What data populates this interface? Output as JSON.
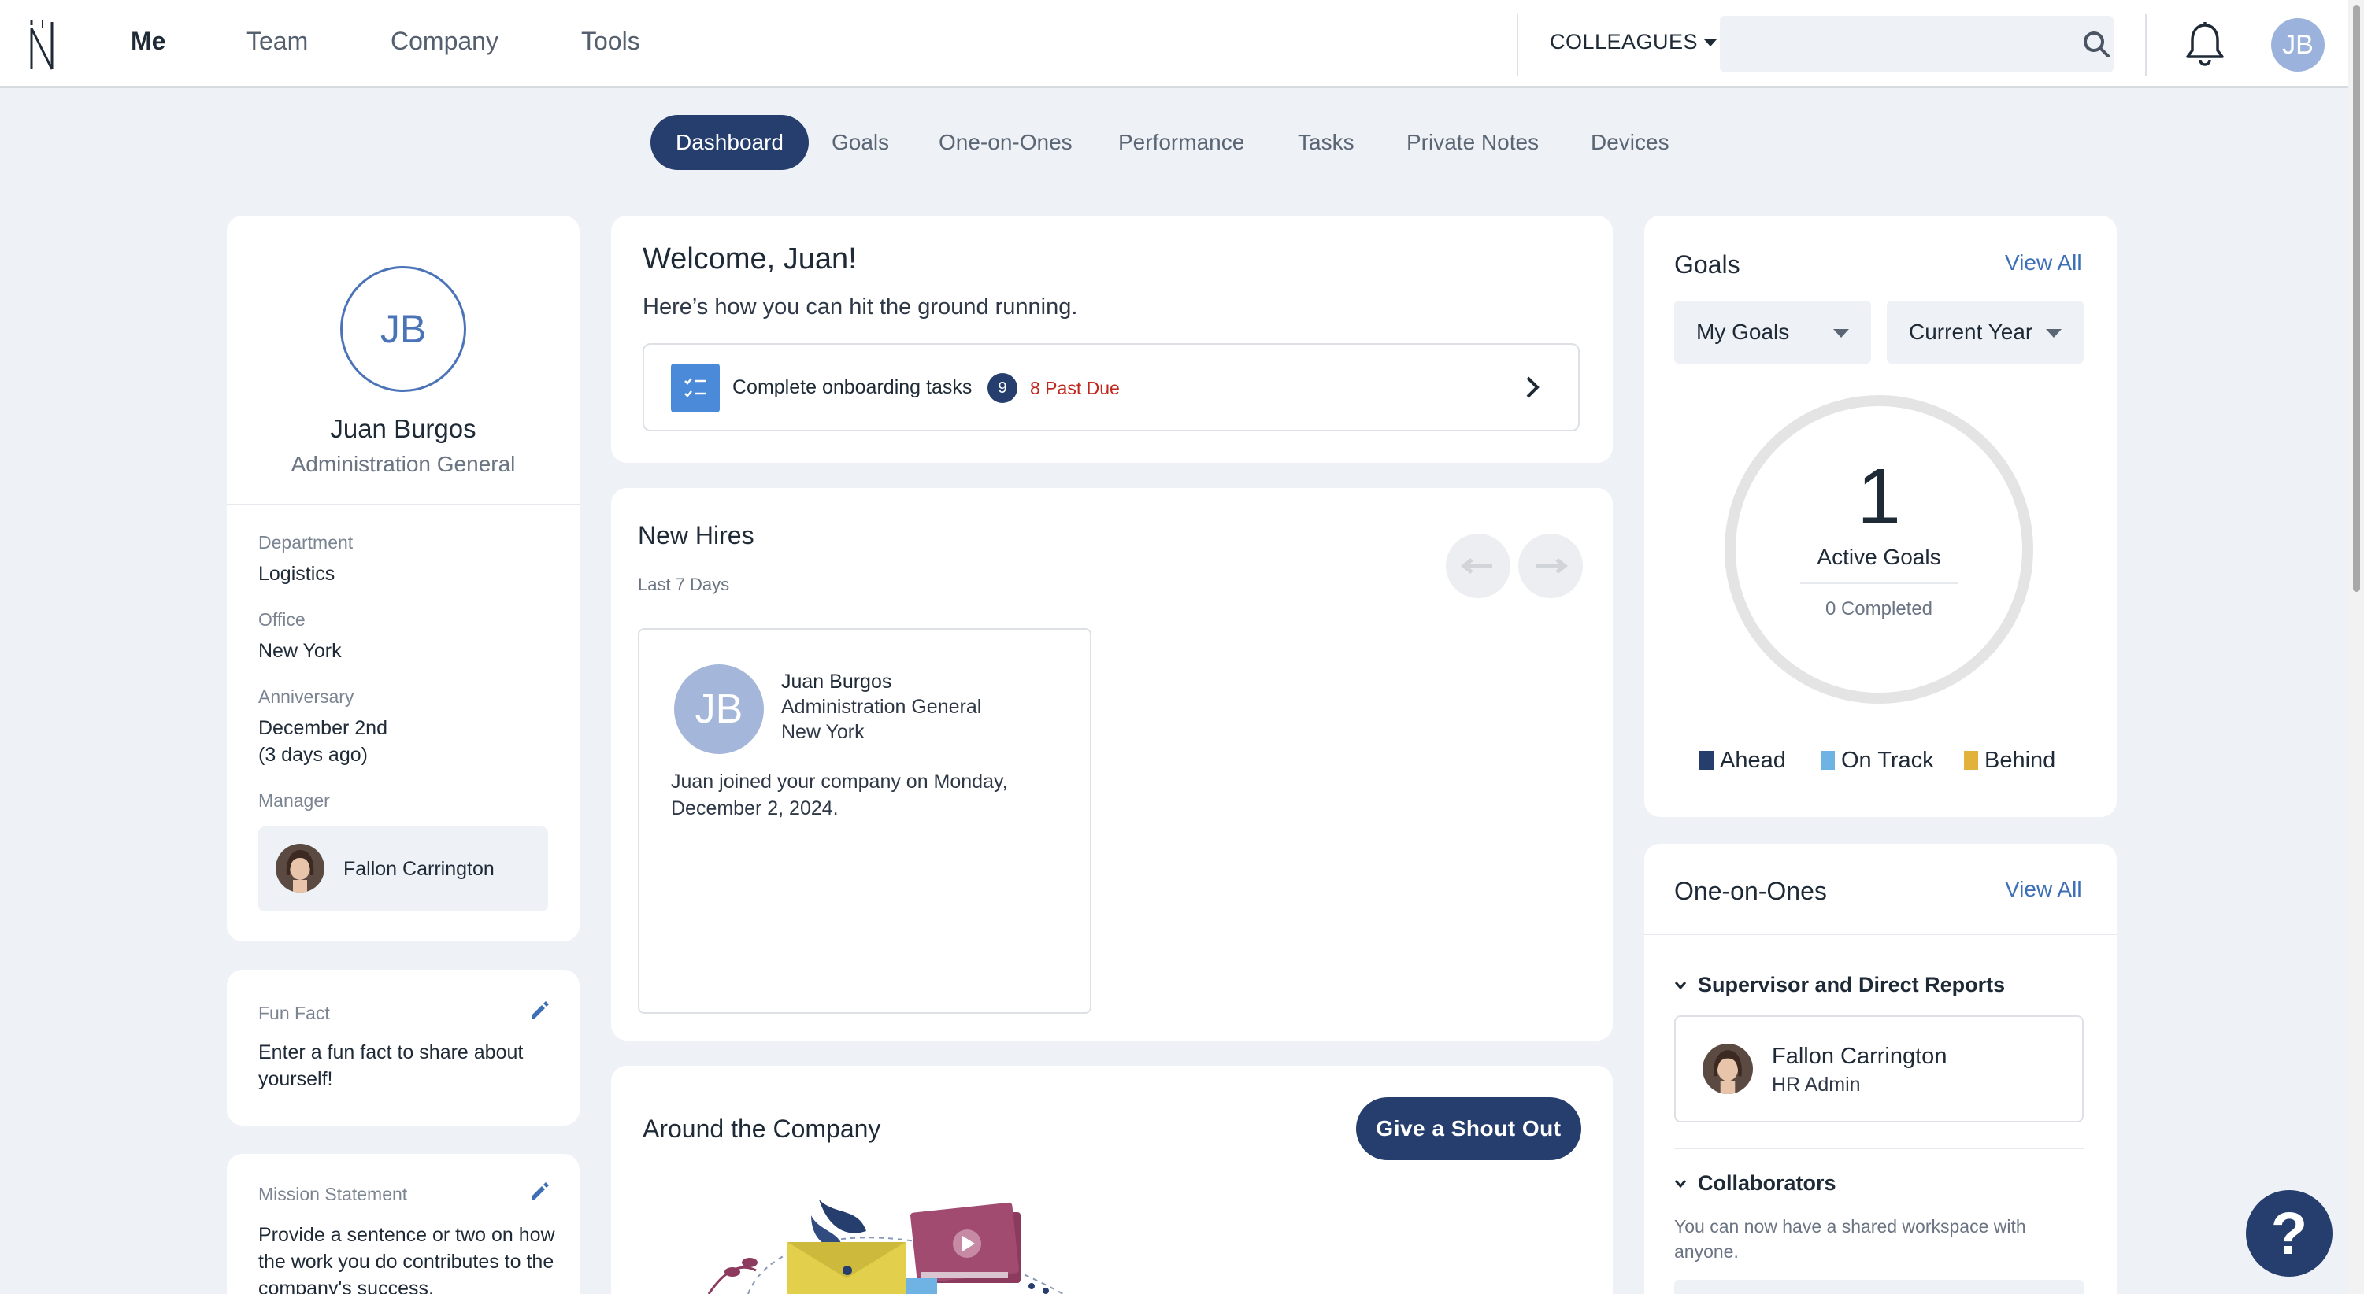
{
  "nav": {
    "items": [
      {
        "label": "Me"
      },
      {
        "label": "Team"
      },
      {
        "label": "Company"
      },
      {
        "label": "Tools"
      }
    ],
    "colleagues_label": "COLLEAGUES",
    "search_placeholder": "",
    "avatar_initials": "JB"
  },
  "tabs": [
    {
      "label": "Dashboard"
    },
    {
      "label": "Goals"
    },
    {
      "label": "One-on-Ones"
    },
    {
      "label": "Performance"
    },
    {
      "label": "Tasks"
    },
    {
      "label": "Private Notes"
    },
    {
      "label": "Devices"
    }
  ],
  "profile": {
    "initials": "JB",
    "name": "Juan Burgos",
    "title": "Administration General",
    "department_label": "Department",
    "department": "Logistics",
    "office_label": "Office",
    "office": "New York",
    "anniversary_label": "Anniversary",
    "anniversary_date": "December 2nd",
    "anniversary_ago": "(3 days ago)",
    "manager_label": "Manager",
    "manager_name": "Fallon Carrington"
  },
  "fun_fact": {
    "label": "Fun Fact",
    "text": "Enter a fun fact to share about yourself!"
  },
  "mission": {
    "label": "Mission Statement",
    "text": "Provide a sentence or two on how the work you do contributes to the company's success."
  },
  "welcome": {
    "heading": "Welcome, Juan!",
    "subtitle": "Here’s how you can hit the ground running.",
    "task_label": "Complete onboarding tasks",
    "task_count": "9",
    "past_due": "8 Past Due"
  },
  "new_hires": {
    "title": "New Hires",
    "subtitle": "Last 7 Days",
    "hire": {
      "initials": "JB",
      "name": "Juan Burgos",
      "title": "Administration General",
      "office": "New York",
      "description": "Juan joined your company on Monday, December 2, 2024."
    }
  },
  "around": {
    "title": "Around the Company",
    "button": "Give a Shout Out"
  },
  "goals": {
    "title": "Goals",
    "view_all": "View All",
    "filter1": "My Goals",
    "filter2": "Current Year",
    "count": "1",
    "count_label": "Active Goals",
    "completed": "0 Completed",
    "legend": [
      {
        "label": "Ahead",
        "color": "#253e6d"
      },
      {
        "label": "On Track",
        "color": "#6fb3e4"
      },
      {
        "label": "Behind",
        "color": "#e2b33c"
      }
    ]
  },
  "one_on_ones": {
    "title": "One-on-Ones",
    "view_all": "View All",
    "group1": "Supervisor and Direct Reports",
    "person_name": "Fallon Carrington",
    "person_role": "HR Admin",
    "group2": "Collaborators",
    "collab_text": "You can now have a shared workspace with anyone."
  },
  "help_label": "?"
}
